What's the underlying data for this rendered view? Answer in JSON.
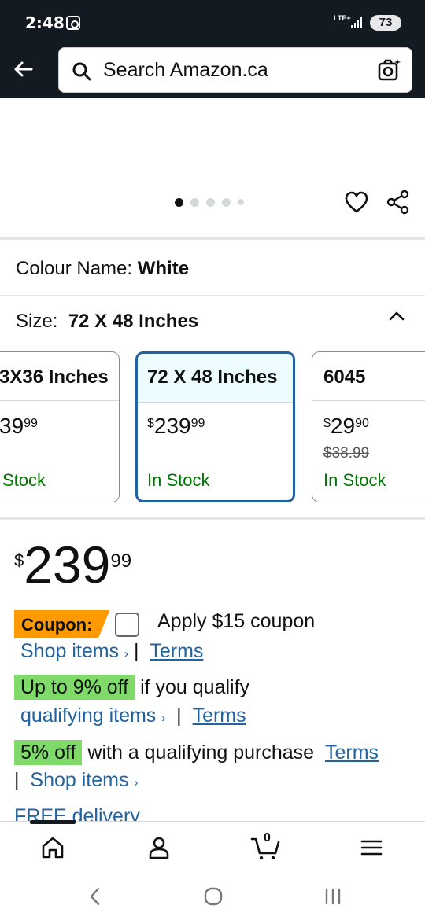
{
  "status_bar": {
    "time": "2:48",
    "network": "LTE+",
    "battery": "73"
  },
  "search": {
    "placeholder": "Search Amazon.ca"
  },
  "product": {
    "colour_label": "Colour Name:",
    "colour_value": "White",
    "size_label": "Size:",
    "size_value": "72 X 48 Inches",
    "carousel": {
      "total": 5,
      "active": 1
    },
    "size_options": [
      {
        "name": "3X36 Inches",
        "price_currency": "",
        "price_whole": "39",
        "price_frac": "99",
        "stock": "Stock",
        "selected": false
      },
      {
        "name": "72 X 48 Inches",
        "price_currency": "$",
        "price_whole": "239",
        "price_frac": "99",
        "stock": "In Stock",
        "selected": true
      },
      {
        "name": "6045",
        "price_currency": "$",
        "price_whole": "29",
        "price_frac": "90",
        "strike": "$38.99",
        "stock": "In Stock",
        "selected": false
      }
    ],
    "price": {
      "currency": "$",
      "whole": "239",
      "fraction": "99"
    }
  },
  "offers": {
    "coupon_badge": "Coupon:",
    "coupon_text": "Apply $15 coupon",
    "shop_items": "Shop items",
    "terms": "Terms",
    "separator": "|",
    "discount_badge": "Up to 9% off",
    "discount_text": "if you qualify",
    "qualifying_items": "qualifying items",
    "five_off_badge": "5% off",
    "five_off_text": "with a qualifying purchase",
    "free_delivery": "FREE delivery"
  },
  "bottom_nav": {
    "items": [
      "home-icon",
      "account-icon",
      "cart-icon",
      "menu-icon"
    ],
    "cart_count": "0"
  },
  "colors": {
    "header_bg": "#131a22",
    "link": "#2162a1",
    "in_stock": "#007600",
    "coupon": "#ff9900",
    "green_badge": "#7fda69",
    "selected_border": "#2162a1"
  }
}
